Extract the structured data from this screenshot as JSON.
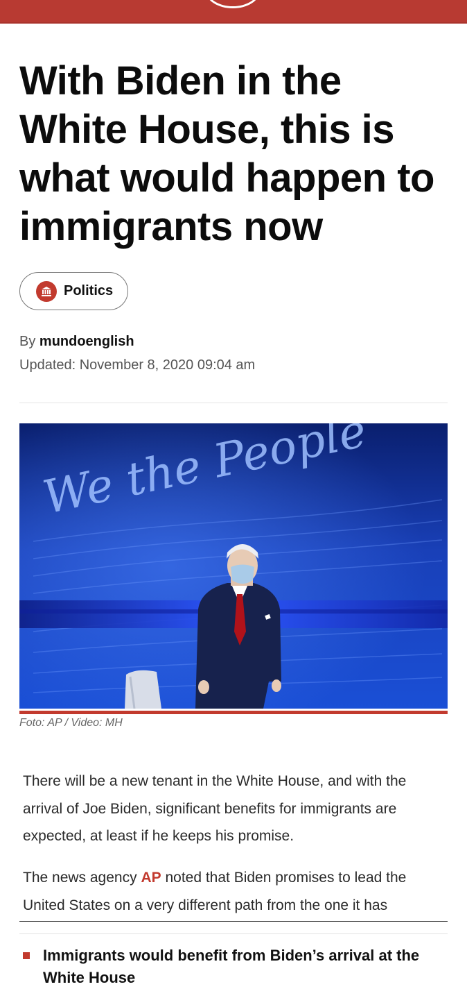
{
  "article": {
    "headline": "With Biden in the White House, this is what would happen to immigrants now",
    "category": {
      "label": "Politics",
      "icon": "bank-icon",
      "icon_color": "#c23a2e"
    },
    "byline_prefix": "By",
    "author": "mundoenglish",
    "updated": "Updated: November 8, 2020 09:04 am",
    "image_caption": "Foto: AP / Video: MH",
    "image_text": "We the People",
    "paragraphs": [
      "There will be a new tenant in the White House, and with the arrival of Joe Biden, significant benefits for immigrants are expected, at least if he keeps his promise."
    ],
    "para2": {
      "before": "The news agency ",
      "link": "AP",
      "after": " noted that Biden promises to lead the United States on a very different path from the one it has"
    },
    "bullets": [
      "Immigrants would benefit from Biden’s arrival at the White House"
    ]
  },
  "colors": {
    "brand": "#b83a32",
    "accent": "#c23a2e",
    "hero_blue": "#1c4fd0"
  }
}
